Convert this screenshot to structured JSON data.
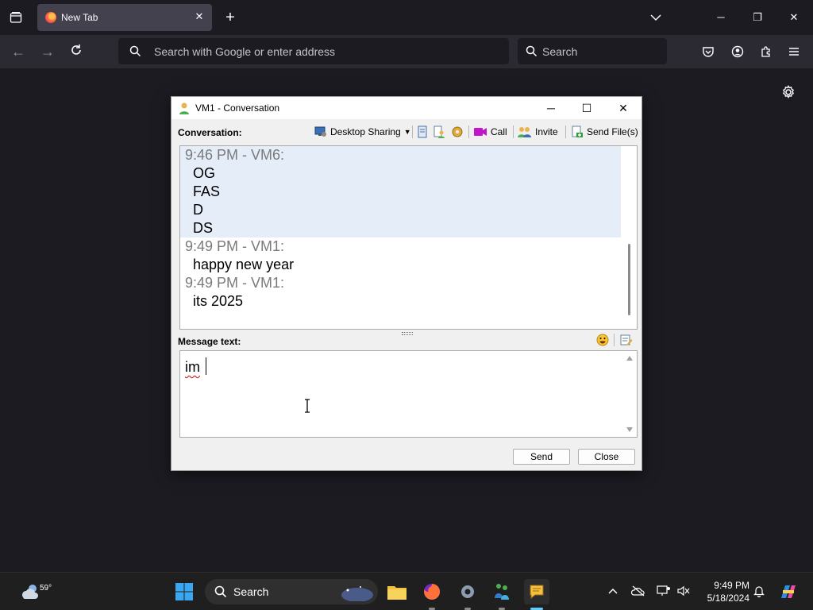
{
  "browser": {
    "tab_title": "New Tab",
    "url_placeholder": "Search with Google or enter address",
    "search_placeholder": "Search"
  },
  "conversation": {
    "window_title": "VM1 - Conversation",
    "conversation_label": "Conversation:",
    "toolbar": {
      "desktop_sharing": "Desktop Sharing",
      "call": "Call",
      "invite": "Invite",
      "send_files": "Send File(s)"
    },
    "messages": [
      {
        "time": "9:46 PM - VM6:",
        "lines": [
          "OG",
          "FAS",
          "D",
          "DS"
        ]
      },
      {
        "time": "9:49 PM - VM1:",
        "lines": [
          "happy new year"
        ]
      },
      {
        "time": "9:49 PM - VM1:",
        "lines": [
          "its 2025"
        ]
      }
    ],
    "message_label": "Message text:",
    "message_input": "im",
    "send_button": "Send",
    "close_button": "Close"
  },
  "taskbar": {
    "temperature": "59°",
    "search_label": "Search",
    "time": "9:49 PM",
    "date": "5/18/2024"
  },
  "colors": {
    "firefox_bg": "#1c1b22",
    "toolbar_bg": "#2b2a33",
    "highlight": "#e4edf8",
    "taskbar_bg": "#1f1f1f"
  }
}
